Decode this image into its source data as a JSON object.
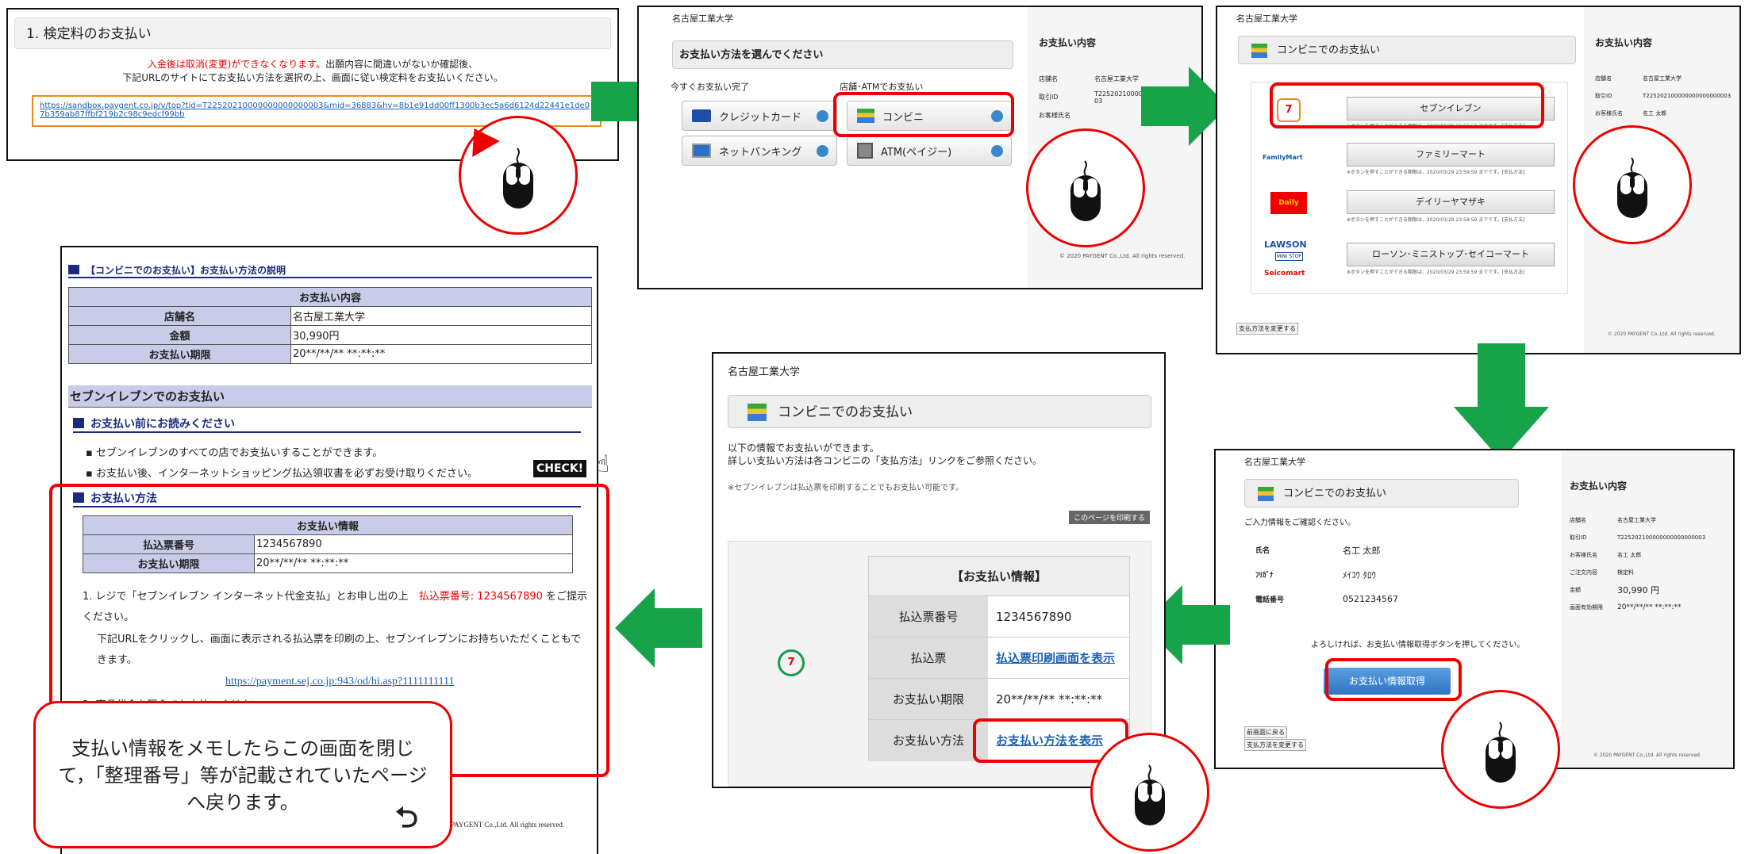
{
  "p1": {
    "title": "1. 検定料のお支払い",
    "warn_red": "入金後は取消(変更)ができなくなります。",
    "warn_rest": "出願内容に間違いがないか確認後、",
    "line2": "下記URLのサイトにてお支払い方法を選択の上、画面に従い検定料をお支払いください。",
    "url": "https://sandbox.paygent.co.jp/v/top?tid=T22520210000000000000003&mid=36883&hv=8b1e91dd00ff1300b3ec5a6d6124d22441e1de07b359ab87ffbf219b2c98c9edcf99bb"
  },
  "p2": {
    "univ": "名古屋工業大学",
    "header": "お支払い方法を選んでください",
    "now_label": "今すぐお支払い完了",
    "store_label": "店舗･ATMでお支払い",
    "btn_credit": "クレジットカード",
    "btn_conv": "コンビニ",
    "btn_net": "ネットバンキング",
    "btn_atm": "ATM(ペイジー)",
    "side_title": "お支払い内容",
    "rows": [
      [
        "店舗名",
        "名古屋工業大学"
      ],
      [
        "取引ID",
        "T225202100000000000000003"
      ],
      [
        "お客様氏名",
        ""
      ]
    ],
    "copyright": "© 2020 PAYGENT Co.,Ltd. All rights reserved."
  },
  "p3": {
    "univ": "名古屋工業大学",
    "header": "コンビニでのお支払い",
    "stores": [
      "セブンイレブン",
      "ファミリーマート",
      "デイリーヤマザキ",
      "ローソン･ミニストップ･セイコーマート"
    ],
    "note": "※ボタンを押すことができる期限は、2020/03/29 23:59:59 までです。[支払方法]",
    "logos": [
      "7",
      "FamilyMart",
      "Daily",
      "LAWSON",
      "MINI STOP",
      "Seicomart"
    ],
    "change": "支払方法を変更する",
    "side_title": "お支払い内容",
    "rows": [
      [
        "店舗名",
        "名古屋工業大学"
      ],
      [
        "取引ID",
        "T225202100000000000000003"
      ],
      [
        "お客様氏名",
        "名工 太郎"
      ]
    ],
    "copyright": "© 2020 PAYGENT Co.,Ltd. All rights reserved."
  },
  "p4": {
    "univ": "名古屋工業大学",
    "header": "コンビニでのお支払い",
    "confirm": "ご入力情報をご確認ください。",
    "rows": [
      [
        "氏名",
        "名工 太郎"
      ],
      [
        "ﾌﾘｶﾞﾅ",
        "ﾒｲｺｳ ﾀﾛｳ"
      ],
      [
        "電話番号",
        "0521234567"
      ]
    ],
    "prompt": "よろしければ、お支払い情報取得ボタンを押してください。",
    "btn": "お支払い情報取得",
    "back1": "前画面に戻る",
    "back2": "支払方法を変更する",
    "side_title": "お支払い内容",
    "side_rows": [
      [
        "店舗名",
        "名古屋工業大学"
      ],
      [
        "取引ID",
        "T225202100000000000000003"
      ],
      [
        "お客様氏名",
        "名工 太郎"
      ],
      [
        "ご注文内容",
        "検定料"
      ],
      [
        "金額",
        "30,990 円"
      ],
      [
        "画面有効期限",
        "20**/**/** **:**:**"
      ]
    ],
    "copyright": "© 2020 PAYGENT Co.,Ltd. All rights reserved."
  },
  "p5": {
    "univ": "名古屋工業大学",
    "header": "コンビニでのお支払い",
    "info1": "以下の情報でお支払いができます。",
    "info2": "詳しい支払い方法は各コンビニの「支払方法」リンクをご参照ください。",
    "note": "※セブンイレブンは払込票を印刷することでもお支払い可能です。",
    "print_btn": "このページを印刷する",
    "table_title": "【お支払い情報】",
    "r1k": "払込票番号",
    "r1v": "1234567890",
    "r2k": "払込票",
    "r2v": "払込票印刷画面を表示",
    "r3k": "お支払い期限",
    "r3v": "20**/**/** **:**:**",
    "r4k": "お支払い方法",
    "r4v": "お支払い方法を表示"
  },
  "p6": {
    "title": "【コンビニでのお支払い】お支払い方法の説明",
    "tbl_head": "お支払い内容",
    "rows": [
      [
        "店舗名",
        "名古屋工業大学"
      ],
      [
        "金額",
        "30,990円"
      ],
      [
        "お支払い期限",
        "20**/**/** **:**:**"
      ]
    ],
    "section": "セブンイレブンでのお支払い",
    "sub1": "お支払い前にお読みください",
    "b1": "セブンイレブンのすべての店でお支払いすることができます。",
    "b2": "お支払い後、インターネットショッピング払込領収書を必ずお受け取りください。",
    "check": "CHECK!",
    "sub2": "お支払い方法",
    "info_head": "お支払い情報",
    "info_rows": [
      [
        "払込票番号",
        "1234567890"
      ],
      [
        "お支払い期限",
        "20**/**/** **:**:**"
      ]
    ],
    "step1a": "1. レジで「セブンイレブン インターネット代金支払」とお申し出の上",
    "step1red": "払込票番号: 1234567890",
    "step1b": "をご提示ください。",
    "step1c": "下記URLをクリックし、画面に表示される払込票を印刷の上、セブンイレブンにお持ちいただくこともできます。",
    "url": "https://payment.sej.co.jp:943/od/hi.asp?1111111111",
    "step2": "2. 商品代金を現金でお支払いください。",
    "footer": "PAYGENT Co.,Ltd. All rights reserved."
  },
  "callout": {
    "text": "支払い情報をメモしたらこの画面を閉じて，「整理番号」等が記載されていたページへ戻ります。"
  },
  "colors": {
    "arrow": "#16a34a",
    "red": "#e00000",
    "link": "#1a5fb4"
  }
}
